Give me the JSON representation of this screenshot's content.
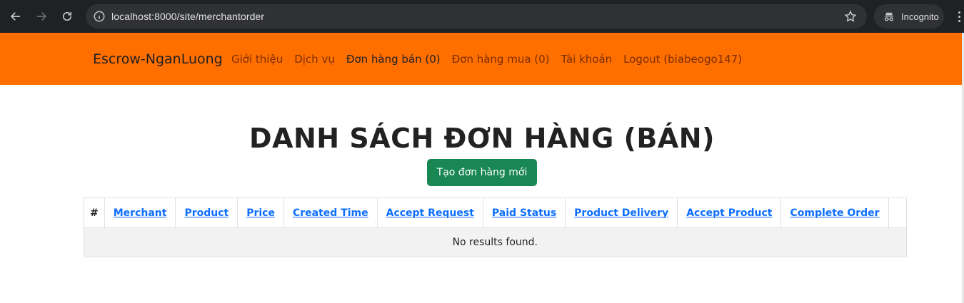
{
  "browser": {
    "url": "localhost:8000/site/merchantorder",
    "incognito_label": "Incognito"
  },
  "navbar": {
    "brand": "Escrow-NganLuong",
    "links": [
      "Giới thiệu",
      "Dịch vụ",
      "Đơn hàng bán (0)",
      "Đơn hàng mua (0)",
      "Tài khoản",
      "Logout (biabeogo147)"
    ],
    "active_index": 2,
    "color": "#ff6f00"
  },
  "main": {
    "title": "DANH SÁCH ĐƠN HÀNG (BÁN)",
    "create_button": "Tạo đơn hàng mới",
    "create_button_color": "#198754"
  },
  "table": {
    "columns": [
      "#",
      "Merchant",
      "Product",
      "Price",
      "Created Time",
      "Accept Request",
      "Paid Status",
      "Product Delivery",
      "Accept Product",
      "Complete Order",
      ""
    ],
    "empty_message": "No results found."
  }
}
